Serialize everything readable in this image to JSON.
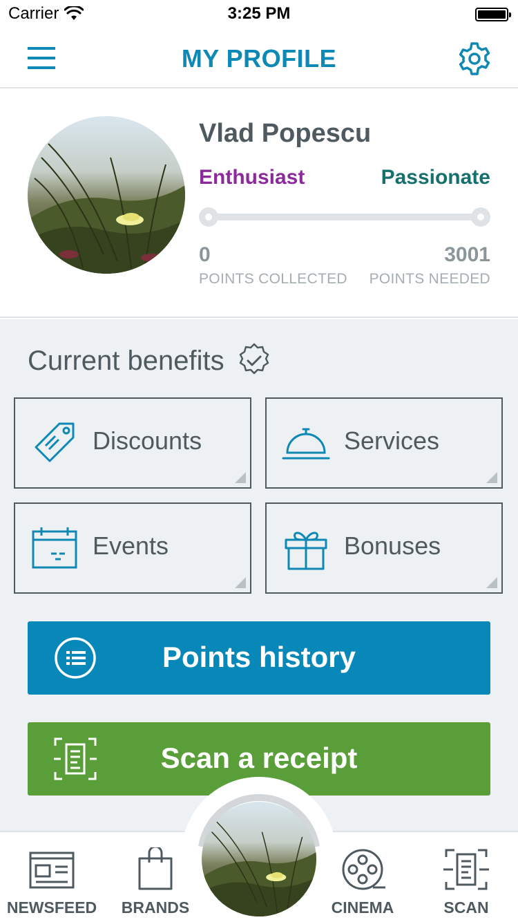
{
  "status": {
    "carrier": "Carrier",
    "time": "3:25 PM"
  },
  "header": {
    "title": "MY PROFILE",
    "menu_icon": "hamburger-menu-icon",
    "settings_icon": "gear-icon"
  },
  "profile": {
    "name": "Vlad Popescu",
    "current_level": "Enthusiast",
    "next_level": "Passionate",
    "progress": 0,
    "points_collected": "0",
    "points_collected_label": "POINTS COLLECTED",
    "points_needed": "3001",
    "points_needed_label": "POINTS NEEDED",
    "colors": {
      "current_level": "#8c2a9c",
      "next_level": "#16706b"
    }
  },
  "benefits": {
    "title": "Current benefits",
    "title_icon": "badge-check-icon",
    "tiles": [
      {
        "label": "Discounts",
        "icon": "tag-icon"
      },
      {
        "label": "Services",
        "icon": "service-bell-icon"
      },
      {
        "label": "Events",
        "icon": "calendar-icon"
      },
      {
        "label": "Bonuses",
        "icon": "gift-icon"
      }
    ]
  },
  "actions": {
    "points_history": {
      "label": "Points history",
      "icon": "list-icon",
      "color": "#0788b9"
    },
    "scan_receipt": {
      "label": "Scan a receipt",
      "icon": "receipt-scan-icon",
      "color": "#5a9e3a"
    }
  },
  "tabbar": {
    "items": [
      {
        "label": "NEWSFEED",
        "icon": "newspaper-icon"
      },
      {
        "label": "BRANDS",
        "icon": "shopping-bag-icon"
      },
      {
        "label": "",
        "icon": "profile-avatar"
      },
      {
        "label": "CINEMA",
        "icon": "film-reel-icon"
      },
      {
        "label": "SCAN",
        "icon": "scan-icon"
      }
    ]
  },
  "colors": {
    "accent": "#0e88b5",
    "text": "#4e5a60",
    "panel_bg": "#eef1f3"
  }
}
